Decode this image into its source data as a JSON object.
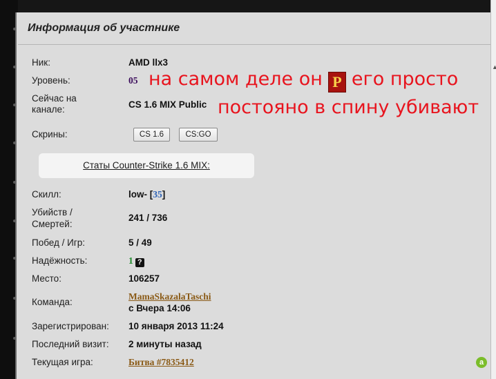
{
  "header": {
    "title": "Информация об участнике"
  },
  "profile": {
    "nick_label": "Ник:",
    "nick_value": "AMD llx3",
    "level_label": "Уровень:",
    "level_value": "05",
    "channel_label_line1": "Сейчас на",
    "channel_label_line2": "каналe:",
    "channel_value": "CS 1.6 MIX Public",
    "screens_label": "Скрины:",
    "screens_buttons": [
      "CS 1.6",
      "CS:GO"
    ]
  },
  "stats": {
    "link_label": "Статы Counter-Strike 1.6 MIX:",
    "skill_label": "Скилл:",
    "skill_text": "low-",
    "skill_number": "35",
    "kd_label_line1": "Убийств /",
    "kd_label_line2": "Смертей:",
    "kd_value": "241 / 736",
    "wins_label": "Побед / Игр:",
    "wins_value": "5 / 49",
    "reliability_label": "Надёжность:",
    "reliability_value": "1",
    "reliability_help": "?",
    "place_label": "Место:",
    "place_value": "106257",
    "team_label": "Команда:",
    "team_name": "MamaSkazalaTaschi",
    "team_since": "с Вчера 14:06",
    "registered_label": "Зарегистрирован:",
    "registered_value": "10 января 2013 11:24",
    "last_visit_label": "Последний визит:",
    "last_visit_value": "2 минуты назад",
    "current_game_label": "Текущая игра:",
    "current_game_value": "Битва #7835412"
  },
  "annotation": {
    "line1_part1": "на самом деле он",
    "badge": "P",
    "line1_part2": "его просто",
    "line2": "постояно в спину убивают",
    "color": "#e8141e"
  },
  "icons": {
    "adblock": "adblock-icon",
    "help": "help-icon"
  }
}
